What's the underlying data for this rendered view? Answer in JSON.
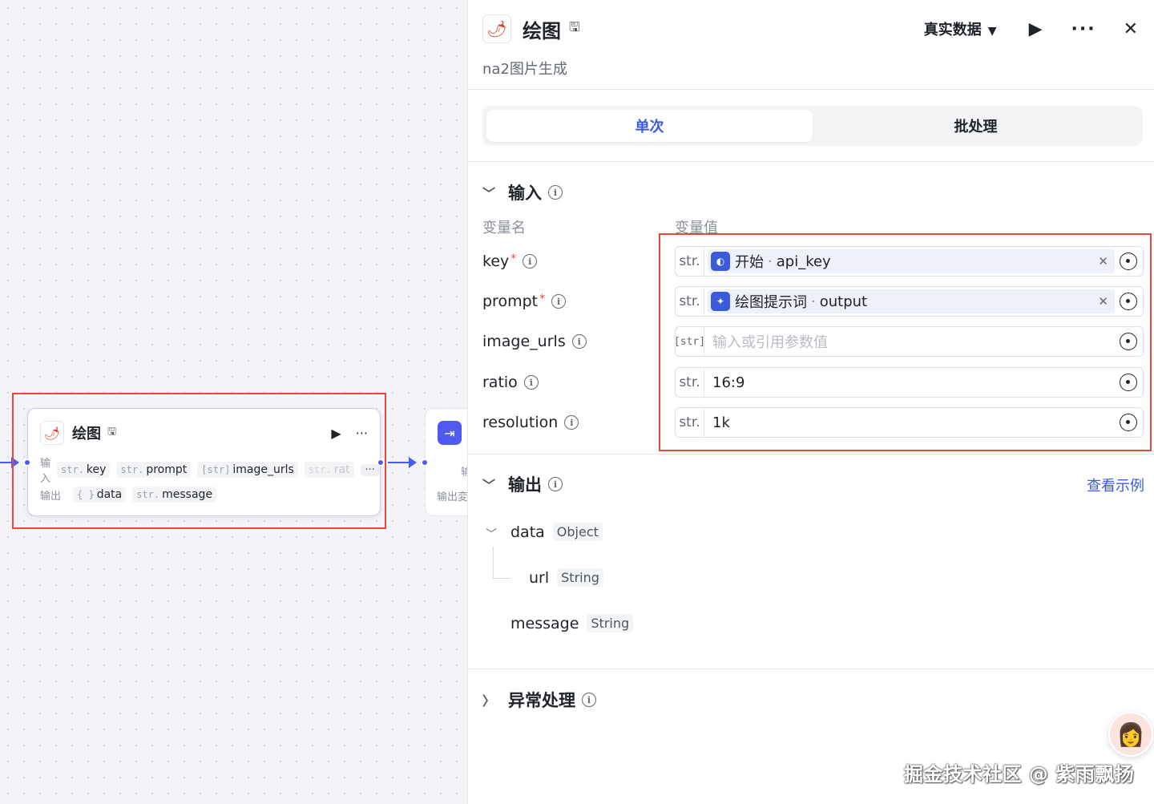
{
  "canvas": {
    "node": {
      "title": "绘图",
      "edit_icon": "edit-icon",
      "input_label": "输入",
      "output_label": "输出",
      "inputs": [
        {
          "type": "str.",
          "name": "key"
        },
        {
          "type": "str.",
          "name": "prompt"
        },
        {
          "type": "[str]",
          "name": "image_urls"
        },
        {
          "type": "str.",
          "name": "rat"
        }
      ],
      "outputs": [
        {
          "type": "{ }",
          "name": "data"
        },
        {
          "type": "str.",
          "name": "message"
        }
      ],
      "more": "···"
    },
    "next_node": {
      "input_partial": "输",
      "output_partial": "输出変"
    }
  },
  "panel": {
    "title": "绘图",
    "subtitle": "na2图片生成",
    "data_mode": "真实数据",
    "tabs": [
      {
        "label": "单次",
        "active": true
      },
      {
        "label": "批处理",
        "active": false
      }
    ],
    "input_section": {
      "title": "输入",
      "col_name": "变量名",
      "col_value": "变量值",
      "rows": [
        {
          "name": "key",
          "required": true,
          "type": "str.",
          "kind": "ref",
          "ref_node": "开始",
          "ref_var": "api_key",
          "ref_icon": "start-icon"
        },
        {
          "name": "prompt",
          "required": true,
          "type": "str.",
          "kind": "ref",
          "ref_node": "绘图提示词",
          "ref_var": "output",
          "ref_icon": "llm-icon"
        },
        {
          "name": "image_urls",
          "required": false,
          "type": "[str]",
          "kind": "placeholder",
          "placeholder": "输入或引用参数值"
        },
        {
          "name": "ratio",
          "required": false,
          "type": "str.",
          "kind": "value",
          "value": "16:9"
        },
        {
          "name": "resolution",
          "required": false,
          "type": "str.",
          "kind": "value",
          "value": "1k"
        }
      ]
    },
    "output_section": {
      "title": "输出",
      "link": "查看示例",
      "fields": [
        {
          "name": "data",
          "type": "Object"
        },
        {
          "name": "url",
          "type": "String"
        },
        {
          "name": "message",
          "type": "String"
        }
      ]
    },
    "error_section": {
      "title": "异常处理"
    }
  },
  "watermark": "掘金技术社区 @ 紫雨飘扬",
  "colors": {
    "accent": "#3b5bdb",
    "edge": "#4f5bf0",
    "highlight": "#e5483f"
  }
}
